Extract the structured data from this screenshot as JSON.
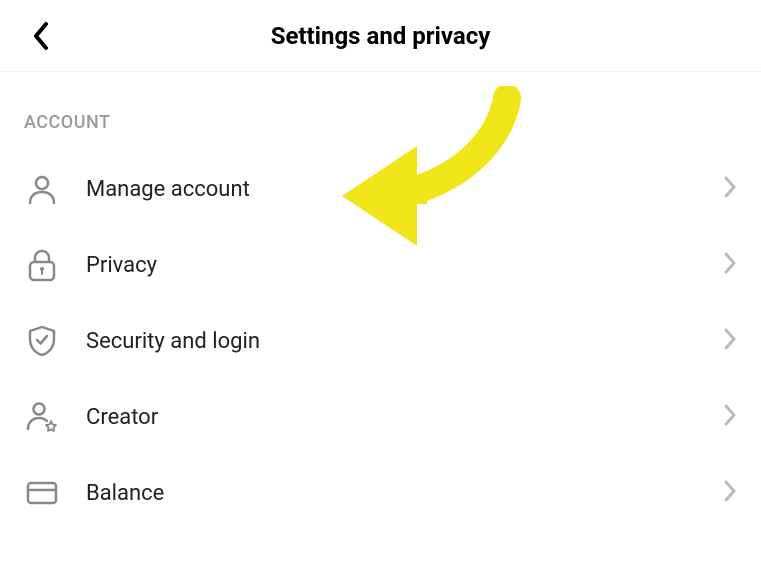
{
  "header": {
    "title": "Settings and privacy"
  },
  "sections": {
    "account": {
      "header": "ACCOUNT",
      "items": [
        {
          "label": "Manage account",
          "icon": "user-icon"
        },
        {
          "label": "Privacy",
          "icon": "lock-icon"
        },
        {
          "label": "Security and login",
          "icon": "shield-check-icon"
        },
        {
          "label": "Creator",
          "icon": "user-star-icon"
        },
        {
          "label": "Balance",
          "icon": "card-icon"
        }
      ]
    }
  },
  "annotation": {
    "type": "arrow",
    "color": "#f0e518",
    "target": "manage-account"
  }
}
